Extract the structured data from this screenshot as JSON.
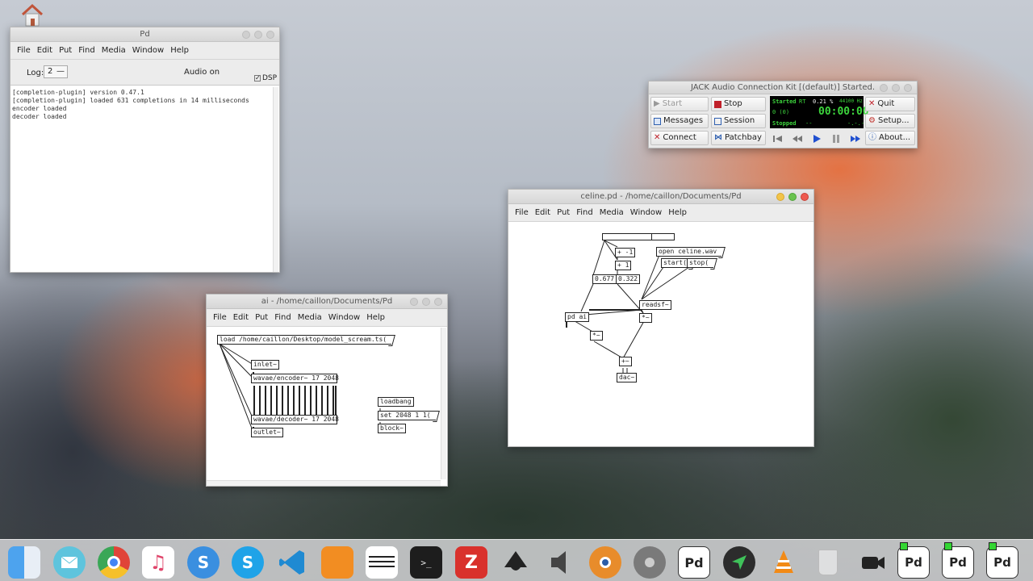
{
  "pd_main": {
    "title": "Pd",
    "menu": [
      "File",
      "Edit",
      "Put",
      "Find",
      "Media",
      "Window",
      "Help"
    ],
    "log_label": "Log:",
    "log_value": "2",
    "audio_status": "Audio on",
    "dsp_label": "DSP",
    "dsp_checked": "✓",
    "console_lines": [
      "[completion-plugin] version 0.47.1",
      "[completion-plugin] loaded 631 completions in 14 milliseconds",
      "encoder loaded",
      "decoder loaded"
    ]
  },
  "ai_window": {
    "title": "ai  - /home/caillon/Documents/Pd",
    "menu": [
      "File",
      "Edit",
      "Put",
      "Find",
      "Media",
      "Window",
      "Help"
    ],
    "objects": {
      "load_msg": "load /home/caillon/Desktop/model_scream.ts(",
      "inlet": "inlet~",
      "encoder": "wavae/encoder~ 17 2048",
      "decoder": "wavae/decoder~ 17 2048",
      "outlet": "outlet~",
      "loadbang": "loadbang",
      "set_msg": "set 2048 1 1(",
      "block": "block~"
    }
  },
  "celine_window": {
    "title": "celine.pd  - /home/caillon/Documents/Pd",
    "menu": [
      "File",
      "Edit",
      "Window",
      "Help"
    ],
    "menu_full": [
      "File",
      "Edit",
      "Put",
      "Find",
      "Media",
      "Window",
      "Help"
    ],
    "objects": {
      "open_msg": "open celine.wav",
      "start_msg": "start(",
      "stop_msg": "stop(",
      "minus1": "+ -1",
      "plus1": "+ 1",
      "num_a": "0.677",
      "num_b": "0.322",
      "readsf": "readsf~",
      "mul1": "*~",
      "mul2": "*~",
      "pd_ai": "pd ai",
      "add": "+~",
      "dac": "dac~"
    },
    "slider_value": 0.677
  },
  "jack": {
    "title": "JACK Audio Connection Kit [(default)] Started.",
    "buttons": {
      "start": "Start",
      "stop": "Stop",
      "messages": "Messages",
      "session": "Session",
      "connect": "Connect",
      "patchbay": "Patchbay",
      "quit": "Quit",
      "setup": "Setup...",
      "about": "About..."
    },
    "display": {
      "state": "Started",
      "rt": "RT",
      "dsp_load": "0.21 %",
      "sample_rate": "44100 Hz",
      "xruns": "0 (0)",
      "time": "00:00:00",
      "transport_state": "Stopped",
      "dash1": "--",
      "dash2": "-.-.-"
    }
  },
  "dock": {
    "items": [
      "finder-icon",
      "mail-icon",
      "chrome-icon",
      "music-icon",
      "simplenote-icon",
      "skype-icon",
      "vscode-icon",
      "sublime-merge-icon",
      "mixer-icon",
      "terminal-icon",
      "zotero-icon",
      "inkscape-icon",
      "audio-icon",
      "blender-icon",
      "disk-icon",
      "pd-icon",
      "navigator-icon",
      "vlc-icon",
      "trash-icon",
      "obs-icon",
      "pd-running-1",
      "pd-running-2",
      "pd-running-3"
    ],
    "pd_labels": [
      "Pd",
      "Pd",
      "Pd",
      "Pd"
    ]
  }
}
